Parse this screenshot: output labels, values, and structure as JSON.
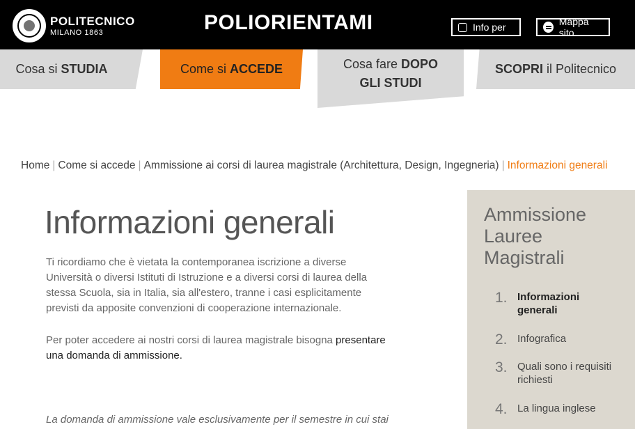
{
  "header": {
    "brand_name": "POLITECNICO",
    "brand_sub": "MILANO 1863",
    "site_title": "POLIORIENTAMI",
    "info_button": "Info per",
    "map_button": "Mappa sito"
  },
  "nav": [
    {
      "pre": "Cosa si ",
      "bold": "STUDIA",
      "post": ""
    },
    {
      "pre": "Come si ",
      "bold": "ACCEDE",
      "post": ""
    },
    {
      "pre": "Cosa fare ",
      "bold": "DOPO GLI STUDI",
      "post": ""
    },
    {
      "pre": "",
      "bold": "SCOPRI",
      "post": " il Politecnico"
    }
  ],
  "accent_color": "#f07c13",
  "breadcrumb": {
    "items": [
      "Home",
      "Come si accede",
      "Ammissione ai corsi di laurea magistrale (Architettura, Design, Ingegneria)"
    ],
    "current": "Informazioni generali"
  },
  "main": {
    "title": "Informazioni generali",
    "para1": "Ti ricordiamo che è vietata la contemporanea iscrizione a diverse Università o diversi Istituti di Istruzione e a diversi corsi di laurea della stessa Scuola, sia in Italia, sia all'estero, tranne i casi esplicitamente previsti da apposite convenzioni di cooperazione internazionale.",
    "para2_plain": "Per poter accedere ai nostri corsi di laurea magistrale bisogna ",
    "para2_strong": "presentare una domanda di ammissione.",
    "para3": "La domanda di ammissione vale esclusivamente per il semestre in cui stai"
  },
  "sidebar": {
    "title": "Ammissione Lauree Magistrali",
    "items": [
      {
        "num": "1.",
        "label": "Informazioni generali"
      },
      {
        "num": "2.",
        "label": "Infografica"
      },
      {
        "num": "3.",
        "label": "Quali sono i requisiti richiesti"
      },
      {
        "num": "4.",
        "label": "La lingua inglese"
      }
    ]
  }
}
